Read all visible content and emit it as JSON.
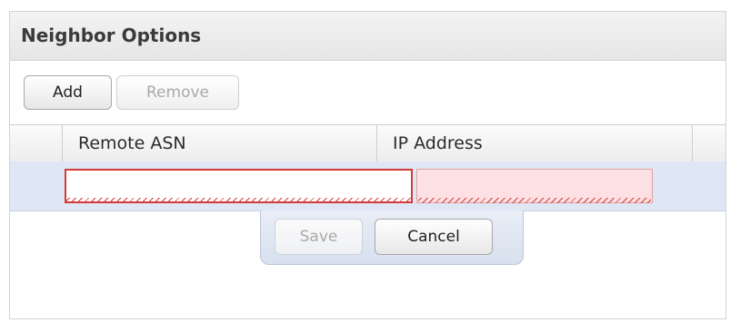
{
  "panel": {
    "title": "Neighbor Options"
  },
  "toolbar": {
    "add_label": "Add",
    "remove_label": "Remove"
  },
  "grid": {
    "columns": [
      "Remote ASN",
      "IP Address"
    ],
    "edit_row": {
      "remote_asn": "",
      "ip_address": ""
    }
  },
  "actions": {
    "save_label": "Save",
    "cancel_label": "Cancel"
  },
  "colors": {
    "invalid_border": "#d43a3a",
    "invalid_fill": "#fde0e3",
    "row_highlight": "#dfe7f5"
  }
}
